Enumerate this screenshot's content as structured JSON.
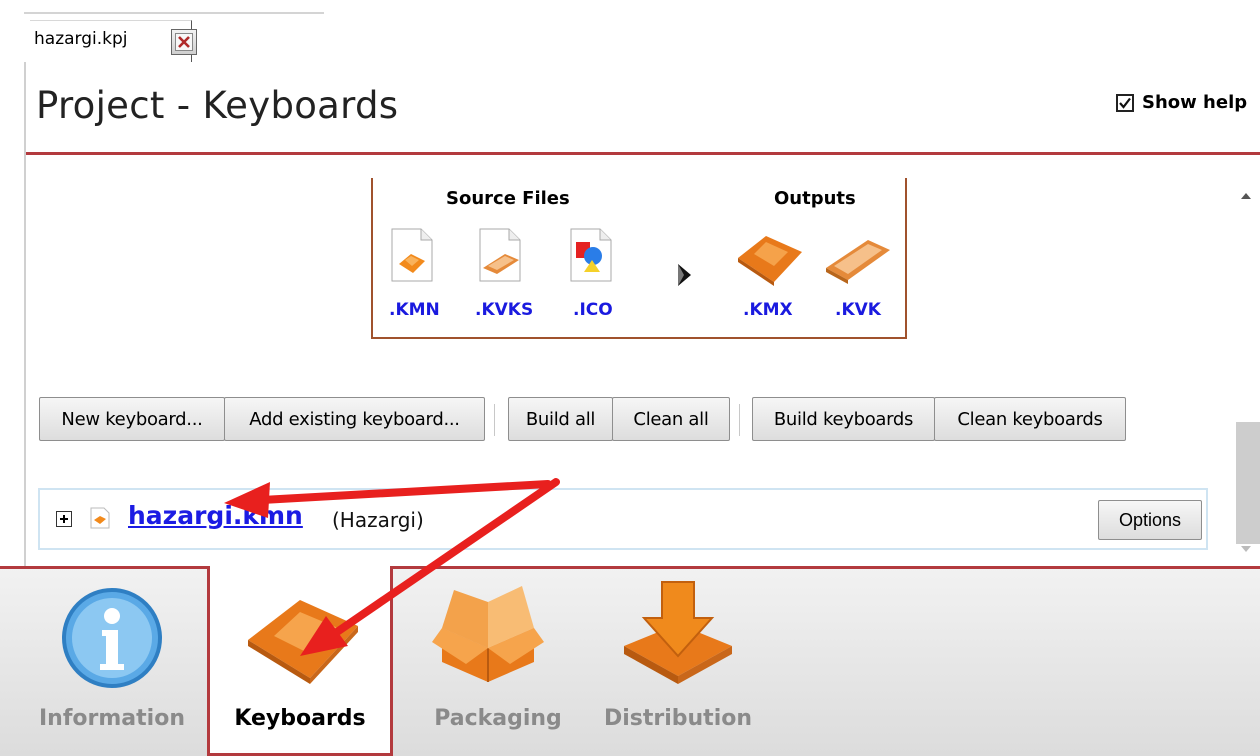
{
  "tab": {
    "file_name": "hazargi.kpj"
  },
  "header": {
    "title": "Project - Keyboards",
    "show_help_label": "Show help",
    "show_help_checked": true
  },
  "diagram": {
    "source_heading": "Source Files",
    "outputs_heading": "Outputs",
    "source_files": [
      {
        "ext": ".KMN",
        "icon": "kmn-file-icon"
      },
      {
        "ext": ".KVKS",
        "icon": "kvks-file-icon"
      },
      {
        "ext": ".ICO",
        "icon": "ico-file-icon"
      }
    ],
    "outputs": [
      {
        "ext": ".KMX",
        "icon": "kmx-output-icon"
      },
      {
        "ext": ".KVK",
        "icon": "kvk-output-icon"
      }
    ]
  },
  "toolbar": {
    "new_keyboard": "New keyboard...",
    "add_existing": "Add existing keyboard...",
    "build_all": "Build all",
    "clean_all": "Clean all",
    "build_keyboards": "Build keyboards",
    "clean_keyboards": "Clean keyboards"
  },
  "keyboards": [
    {
      "file": "hazargi.kmn",
      "name": "(Hazargi)",
      "options_label": "Options"
    }
  ],
  "nav": {
    "information": "Information",
    "keyboards": "Keyboards",
    "packaging": "Packaging",
    "distribution": "Distribution",
    "selected": "Keyboards"
  },
  "colors": {
    "accent_red": "#b33a3e",
    "link_blue": "#1c1ce3",
    "keyboard_orange": "#f0861e",
    "annotation_arrow": "#e8201e"
  }
}
